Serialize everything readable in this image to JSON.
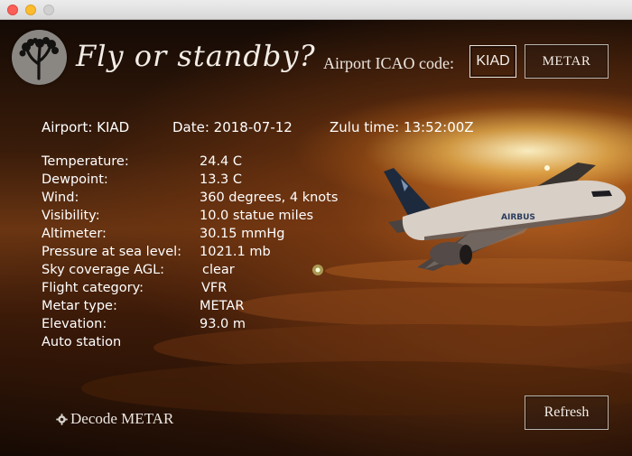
{
  "app": {
    "title": "Fly or standby?"
  },
  "icao": {
    "label": "Airport ICAO code:",
    "value": "KIAD",
    "metar_button": "METAR"
  },
  "summary": {
    "airport": "Airport: KIAD",
    "date": "Date: 2018-07-12",
    "zulu": "Zulu time: 13:52:00Z"
  },
  "details": [
    {
      "label": "Temperature:",
      "value": "24.4 C"
    },
    {
      "label": "Dewpoint:",
      "value": "13.3 C"
    },
    {
      "label": "Wind:",
      "value": "360 degrees, 4 knots"
    },
    {
      "label": "Visibility:",
      "value": "10.0 statue miles"
    },
    {
      "label": "Altimeter:",
      "value": "30.15 mmHg"
    },
    {
      "label": "Pressure at sea level:",
      "value": "1021.1 mb"
    },
    {
      "label": "Sky coverage AGL:",
      "value": "clear"
    },
    {
      "label": "Flight category:",
      "value": "VFR"
    },
    {
      "label": "Metar type:",
      "value": "METAR"
    },
    {
      "label": "Elevation:",
      "value": "93.0 m"
    },
    {
      "label": "Auto station",
      "value": ""
    }
  ],
  "footer": {
    "decode_label": "Decode METAR",
    "refresh_button": "Refresh"
  },
  "aircraft_livery": "AIRBUS"
}
